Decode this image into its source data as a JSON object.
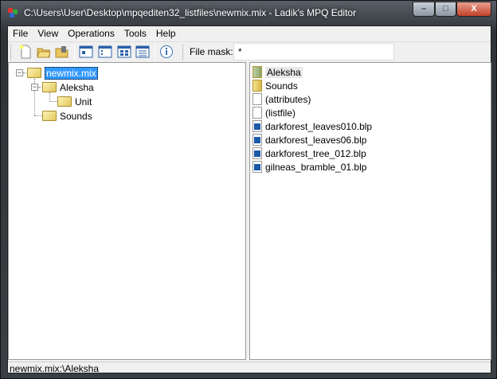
{
  "window": {
    "title": "C:\\Users\\User\\Desktop\\mpqediten32_listfiles\\newmix.mix - Ladik's MPQ Editor",
    "minimize": "–",
    "maximize": "□",
    "close": "X"
  },
  "menu": [
    "File",
    "View",
    "Operations",
    "Tools",
    "Help"
  ],
  "toolbar": {
    "buttons": [
      "new-icon",
      "open-icon",
      "open-folder-icon",
      "view-large-icon",
      "view-small-icon",
      "view-list-icon",
      "view-details-icon",
      "info-icon"
    ],
    "file_mask_label": "File mask:",
    "file_mask_value": "*"
  },
  "tree": [
    {
      "label": "newmix.mix",
      "selected": true
    },
    {
      "label": "Aleksha"
    },
    {
      "label": "Unit"
    },
    {
      "label": "Sounds"
    }
  ],
  "files": [
    {
      "name": "Aleksha",
      "type": "folder"
    },
    {
      "name": "Sounds",
      "type": "folder"
    },
    {
      "name": "(attributes)",
      "type": "file"
    },
    {
      "name": "(listfile)",
      "type": "file"
    },
    {
      "name": "darkforest_leaves010.blp",
      "type": "blp"
    },
    {
      "name": "darkforest_leaves06.blp",
      "type": "blp"
    },
    {
      "name": "darkforest_tree_012.blp",
      "type": "blp"
    },
    {
      "name": "gilneas_bramble_01.blp",
      "type": "blp"
    }
  ],
  "status": "newmix.mix:\\Aleksha"
}
